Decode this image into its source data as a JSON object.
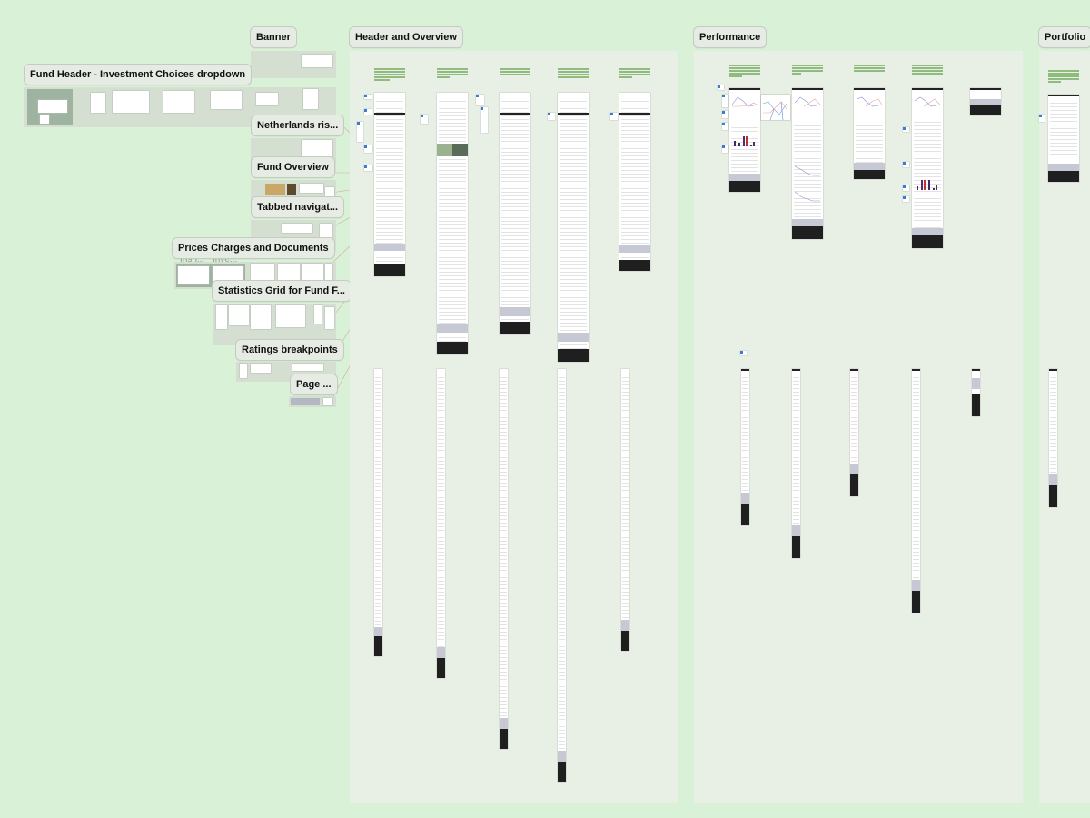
{
  "canvas": {
    "background_color": "#d9f2d7",
    "section_color": "#e8f0e6"
  },
  "sections": [
    {
      "id": "banner",
      "label": "Banner"
    },
    {
      "id": "header-overview",
      "label": "Header and Overview"
    },
    {
      "id": "performance",
      "label": "Performance"
    },
    {
      "id": "portfolio",
      "label": "Portfolio"
    }
  ],
  "component_groups": [
    {
      "id": "fund-header",
      "label": "Fund Header - Investment Choices dropdown"
    },
    {
      "id": "netherlands",
      "label": "Netherlands ris..."
    },
    {
      "id": "fund-overview",
      "label": "Fund Overview"
    },
    {
      "id": "tabbed-nav",
      "label": "Tabbed navigat..."
    },
    {
      "id": "prices",
      "label": "Prices Charges and Documents"
    },
    {
      "id": "statistics",
      "label": "Statistics Grid for Fund F..."
    },
    {
      "id": "ratings",
      "label": "Ratings breakpoints"
    },
    {
      "id": "page",
      "label": "Page ..."
    }
  ],
  "sub_labels": [
    "Irish...",
    "Inve..."
  ],
  "header_overview_frames": [
    {
      "name": "desktop-frame-1"
    },
    {
      "name": "desktop-frame-2"
    },
    {
      "name": "desktop-frame-3"
    },
    {
      "name": "desktop-frame-4"
    },
    {
      "name": "desktop-frame-5"
    }
  ],
  "performance_frames": [
    {
      "name": "performance-frame-1"
    },
    {
      "name": "performance-frame-2"
    },
    {
      "name": "performance-frame-3"
    },
    {
      "name": "performance-frame-4"
    },
    {
      "name": "performance-frame-5"
    }
  ]
}
